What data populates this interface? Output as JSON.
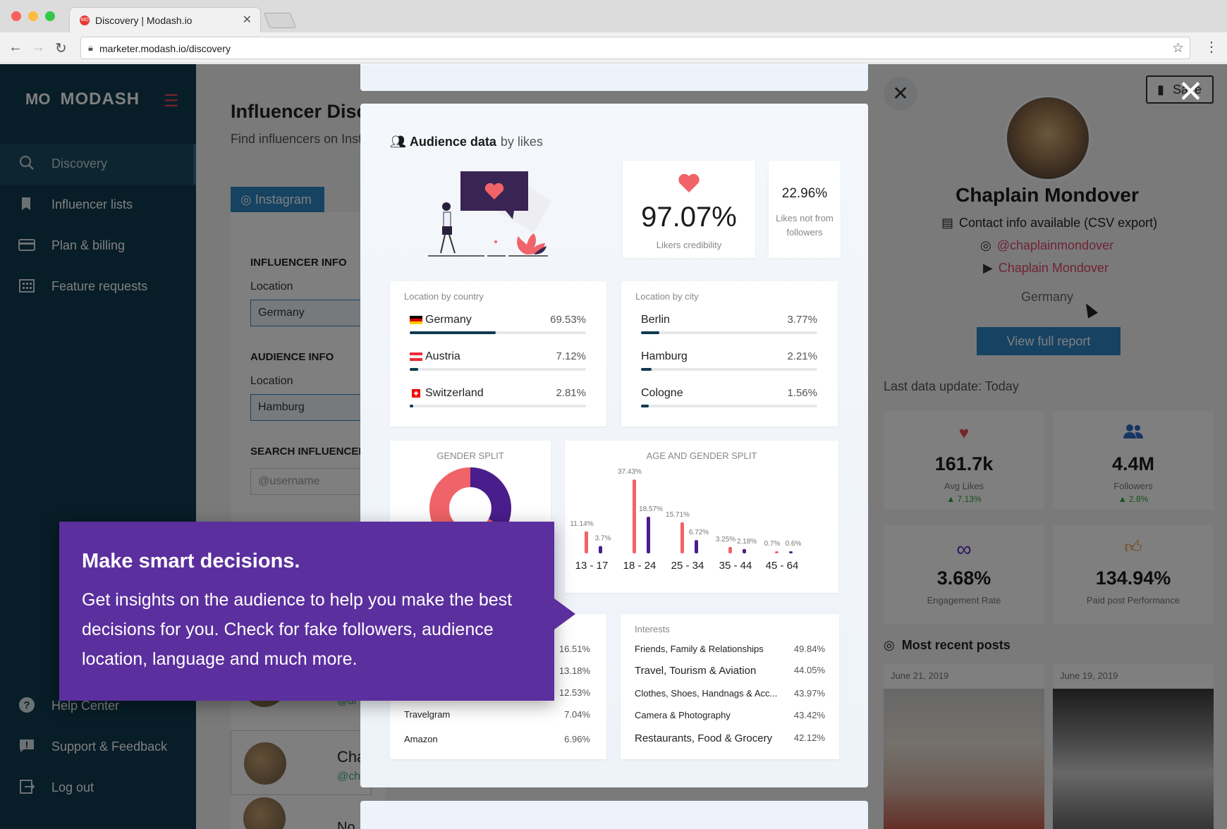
{
  "browser": {
    "tab_title": "Discovery | Modash.io",
    "favicon_text": "MO",
    "url": "marketer.modash.io/discovery"
  },
  "sidebar": {
    "logo_mark": "MO",
    "logo_text": "MODASH",
    "items": [
      {
        "label": "Discovery",
        "icon": "search-icon"
      },
      {
        "label": "Influencer lists",
        "icon": "bookmark-icon"
      },
      {
        "label": "Plan & billing",
        "icon": "credit-card-icon"
      },
      {
        "label": "Feature requests",
        "icon": "building-icon"
      }
    ],
    "bottom_items": [
      {
        "label": "Help Center",
        "icon": "help-icon"
      },
      {
        "label": "Support & Feedback",
        "icon": "chat-icon"
      },
      {
        "label": "Log out",
        "icon": "logout-icon"
      }
    ]
  },
  "main": {
    "title": "Influencer Disc",
    "subtitle": "Find influencers on Inst",
    "platform_tab": "Instagram",
    "influencer_info": "INFLUENCER INFO",
    "location_label": "Location",
    "influencer_location": "Germany",
    "audience_info": "AUDIENCE INFO",
    "audience_location_label": "Location",
    "audience_location": "Hamburg",
    "search_influencer": "SEARCH INFLUENCER",
    "username_placeholder": "@username",
    "row_handle_fragment": "@ul",
    "row_name_fragment": "Cha",
    "row_sub_fragment": "@ch",
    "row_next_fragment": "No"
  },
  "modal": {
    "heading": "Audience data",
    "heading_suffix": "by likes",
    "likers_credibility": {
      "value": "97.07%",
      "label": "Likers credibility"
    },
    "not_from_followers": {
      "value": "22.96%",
      "label": "Likes not from followers"
    },
    "location_by_country": {
      "title": "Location by country",
      "rows": [
        {
          "name": "Germany",
          "pct": "69.53%",
          "value": 69.53,
          "flag": "de"
        },
        {
          "name": "Austria",
          "pct": "7.12%",
          "value": 7.12,
          "flag": "at"
        },
        {
          "name": "Switzerland",
          "pct": "2.81%",
          "value": 2.81,
          "flag": "ch"
        }
      ]
    },
    "location_by_city": {
      "title": "Location by city",
      "rows": [
        {
          "name": "Berlin",
          "pct": "3.77%",
          "value": 3.77
        },
        {
          "name": "Hamburg",
          "pct": "2.21%",
          "value": 2.21
        },
        {
          "name": "Cologne",
          "pct": "1.56%",
          "value": 1.56
        }
      ]
    },
    "gender_split": {
      "title": "GENDER SPLIT"
    },
    "age_gender": {
      "title": "AGE AND GENDER SPLIT"
    },
    "languages": {
      "rows": [
        {
          "name": "",
          "pct": "16.51%"
        },
        {
          "name": "",
          "pct": "13.18%"
        },
        {
          "name": "",
          "pct": "12.53%"
        },
        {
          "name": "Travelgram",
          "pct": "7.04%"
        },
        {
          "name": "Amazon",
          "pct": "6.96%"
        }
      ]
    },
    "interests": {
      "title": "Interests",
      "rows": [
        {
          "name": "Friends, Family & Relationships",
          "pct": "49.84%"
        },
        {
          "name": "Travel, Tourism & Aviation",
          "pct": "44.05%"
        },
        {
          "name": "Clothes, Shoes, Handnags & Acc...",
          "pct": "43.97%"
        },
        {
          "name": "Camera & Photography",
          "pct": "43.42%"
        },
        {
          "name": "Restaurants, Food & Grocery",
          "pct": "42.12%"
        }
      ]
    }
  },
  "chart_data": [
    {
      "type": "pie",
      "title": "GENDER SPLIT",
      "note": "donut partially hidden by tooltip; no values printed"
    },
    {
      "type": "bar",
      "title": "AGE AND GENDER SPLIT",
      "categories": [
        "13 - 17",
        "18 - 24",
        "25 - 34",
        "35 - 44",
        "45 - 64"
      ],
      "series": [
        {
          "values": [
            11.14,
            37.43,
            15.71,
            3.25,
            0.7
          ],
          "labels": [
            "11.14%",
            "37.43%",
            "15.71%",
            "3.25%",
            "0.7%"
          ],
          "color": "#f06368"
        },
        {
          "values": [
            3.7,
            18.57,
            6.72,
            2.18,
            0.6
          ],
          "labels": [
            "3.7%",
            "18.57%",
            "6.72%",
            "2.18%",
            "0.6%"
          ],
          "color": "#4a1d8c"
        }
      ],
      "ylim": [
        0,
        40
      ]
    }
  ],
  "tooltip": {
    "title": "Make smart decisions.",
    "body": "Get insights on the audience to help you make the best decisions for you. Check for fake followers, audience location, language and much more."
  },
  "profile": {
    "save_label": "Save",
    "name": "Chaplain Mondover",
    "contact": "Contact info available (CSV export)",
    "instagram": "@chaplainmondover",
    "youtube": "Chaplain Mondover",
    "country": "Germany",
    "report_button": "View full report",
    "last_update": "Last data update: Today",
    "stats": [
      {
        "value": "161.7k",
        "label": "Avg Likes",
        "change": "▲ 7.13%",
        "icon": "heart-icon"
      },
      {
        "value": "4.4M",
        "label": "Followers",
        "change": "▲ 2.8%",
        "icon": "people-icon"
      },
      {
        "value": "3.68%",
        "label": "Engagement Rate",
        "change": "",
        "icon": "infinity-icon"
      },
      {
        "value": "134.94%",
        "label": "Paid post Performance",
        "change": "",
        "icon": "thumbs-up-icon"
      }
    ],
    "recent_posts_title": "Most recent posts",
    "posts": [
      {
        "date": "June 21, 2019"
      },
      {
        "date": "June 19, 2019"
      }
    ]
  },
  "colors": {
    "sidebar": "#0f3a4e",
    "accent_blue": "#2d86c4",
    "tooltip_purple": "#5b2f9e",
    "female_bar": "#f06368",
    "male_bar": "#4a1d8c",
    "brand_red": "#e74c4c"
  }
}
